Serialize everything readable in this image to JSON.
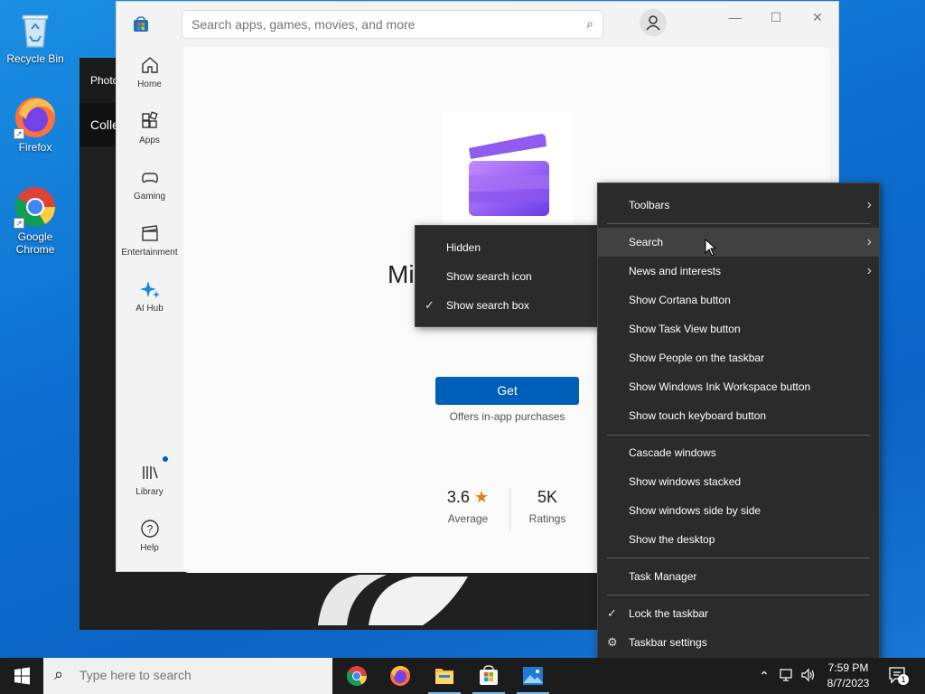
{
  "desktop": {
    "icons": [
      {
        "label": "Recycle Bin"
      },
      {
        "label": "Firefox"
      },
      {
        "label": "Google Chrome"
      }
    ]
  },
  "photos_window": {
    "title": "Photo",
    "collection_label": "Colle"
  },
  "store": {
    "search_placeholder": "Search apps, games, movies, and more",
    "nav": [
      {
        "label": "Home",
        "icon": "home-icon"
      },
      {
        "label": "Apps",
        "icon": "apps-icon"
      },
      {
        "label": "Gaming",
        "icon": "gaming-icon"
      },
      {
        "label": "Entertainment",
        "icon": "entertainment-icon"
      },
      {
        "label": "AI Hub",
        "icon": "ai-hub-icon"
      },
      {
        "label": "Library",
        "icon": "library-icon"
      },
      {
        "label": "Help",
        "icon": "help-icon"
      }
    ],
    "window_controls": {
      "minimize": "—",
      "maximize": "☐",
      "close": "✕"
    },
    "app": {
      "title_fragment": "Mi",
      "get_label": "Get",
      "offers_text": "Offers in-app purchases",
      "rating_value": "3.6",
      "rating_label": "Average",
      "ratings_count": "5K",
      "ratings_label": "Ratings"
    }
  },
  "search_submenu": {
    "items": [
      {
        "label": "Hidden",
        "checked": false
      },
      {
        "label": "Show search icon",
        "checked": false
      },
      {
        "label": "Show search box",
        "checked": true
      }
    ]
  },
  "taskbar_menu": {
    "items": [
      {
        "label": "Toolbars",
        "submenu": true
      },
      {
        "label": "Search",
        "submenu": true,
        "highlighted": true
      },
      {
        "label": "News and interests",
        "submenu": true
      },
      {
        "label": "Show Cortana button"
      },
      {
        "label": "Show Task View button"
      },
      {
        "label": "Show People on the taskbar"
      },
      {
        "label": "Show Windows Ink Workspace button"
      },
      {
        "label": "Show touch keyboard button"
      },
      {
        "label": "Cascade windows"
      },
      {
        "label": "Show windows stacked"
      },
      {
        "label": "Show windows side by side"
      },
      {
        "label": "Show the desktop"
      },
      {
        "label": "Task Manager"
      },
      {
        "label": "Lock the taskbar",
        "checked": true
      },
      {
        "label": "Taskbar settings",
        "icon": "gear-icon"
      }
    ]
  },
  "taskbar": {
    "search_placeholder": "Type here to search",
    "apps": [
      "chrome",
      "firefox",
      "file-explorer",
      "microsoft-store",
      "photos"
    ],
    "time": "7:59 PM",
    "date": "8/7/2023",
    "notification_count": "1"
  },
  "colors": {
    "accent": "#005fb8",
    "menu_bg": "#2b2b2b",
    "taskbar_bg": "#1c1c1c"
  }
}
